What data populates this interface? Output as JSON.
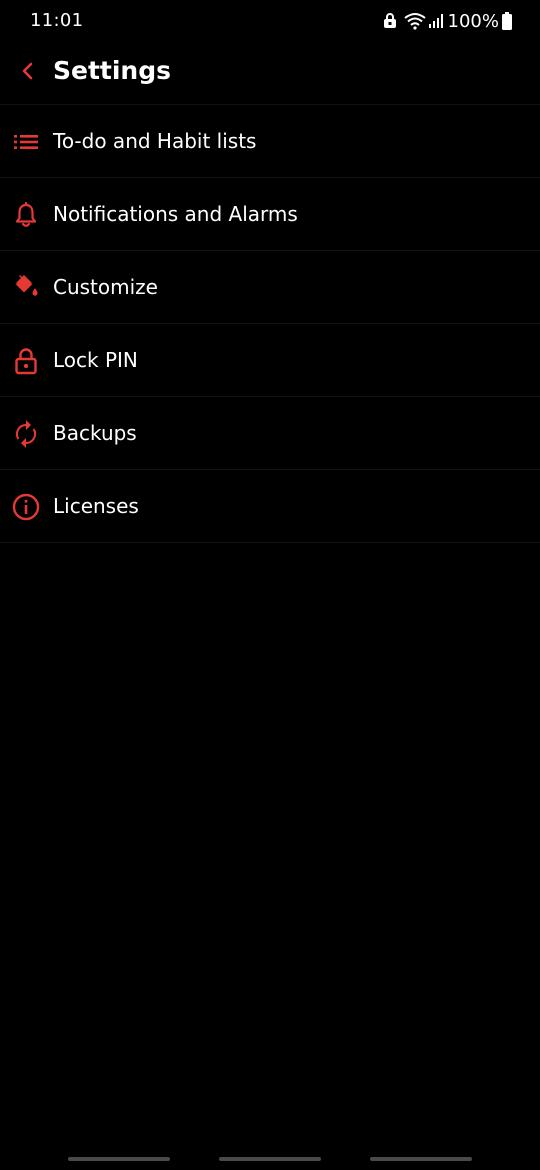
{
  "status_bar": {
    "time": "11:01",
    "battery_percent": "100%"
  },
  "header": {
    "title": "Settings",
    "back_icon": "chevron-left-icon"
  },
  "colors": {
    "accent": "#e53935",
    "background": "#000000",
    "text": "#ffffff",
    "divider": "#141414"
  },
  "settings": {
    "items": [
      {
        "label": "To-do and Habit lists",
        "icon": "list-icon"
      },
      {
        "label": "Notifications and Alarms",
        "icon": "bell-icon"
      },
      {
        "label": "Customize",
        "icon": "paint-bucket-icon"
      },
      {
        "label": "Lock PIN",
        "icon": "lock-icon"
      },
      {
        "label": "Backups",
        "icon": "sync-icon"
      },
      {
        "label": "Licenses",
        "icon": "info-icon"
      }
    ]
  }
}
